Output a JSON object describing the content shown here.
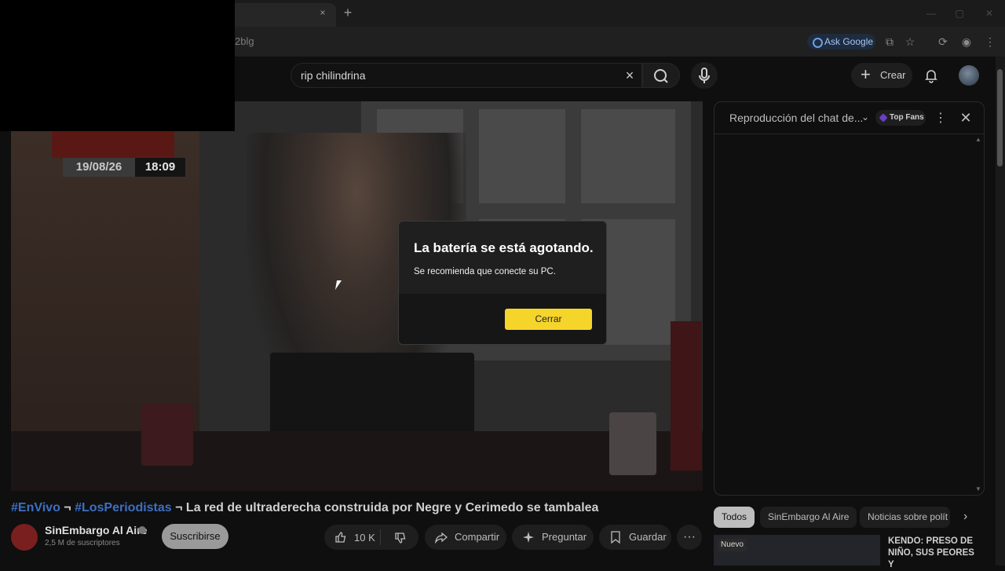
{
  "browser": {
    "url_fragment": "2blg",
    "ask_google_label": "Ask Google",
    "tab_close_icon": "×",
    "new_tab_icon": "+"
  },
  "search": {
    "query": "rip chilindrina",
    "clear_icon": "×"
  },
  "header": {
    "create_label": "Crear"
  },
  "video": {
    "overlay_date": "19/08/26",
    "overlay_time": "18:09"
  },
  "dialog": {
    "title": "La batería se está agotando.",
    "message": "Se recomienda que conecte su PC.",
    "close_button": "Cerrar"
  },
  "video_info": {
    "hashtag1": "#EnVivo",
    "sep1": " ¬ ",
    "hashtag2": "#LosPeriodistas",
    "sep2": " ¬ ",
    "title_text": "La red de ultraderecha construida por Negre y Cerimedo se tambalea",
    "channel_name": "SinEmbargo Al Aire",
    "subscribers": "2,5 M de suscriptores",
    "subscribe_label": "Suscribirse",
    "likes": "10 K",
    "share_label": "Compartir",
    "ask_label": "Preguntar",
    "save_label": "Guardar",
    "more_label": "···"
  },
  "chat": {
    "title": "Reproducción del chat de...",
    "chevron": "⌄",
    "top_fans_label": "Top Fans",
    "menu_icon": "⋮",
    "close_icon": "✕"
  },
  "filters": {
    "chips": [
      "Todos",
      "SinEmbargo Al Aire",
      "Noticias sobre polít"
    ],
    "next_icon": "›"
  },
  "recommendation": {
    "badge": "Nuevo",
    "title": "KENDO: PRESO DE NIÑO, SUS PEORES Y"
  }
}
